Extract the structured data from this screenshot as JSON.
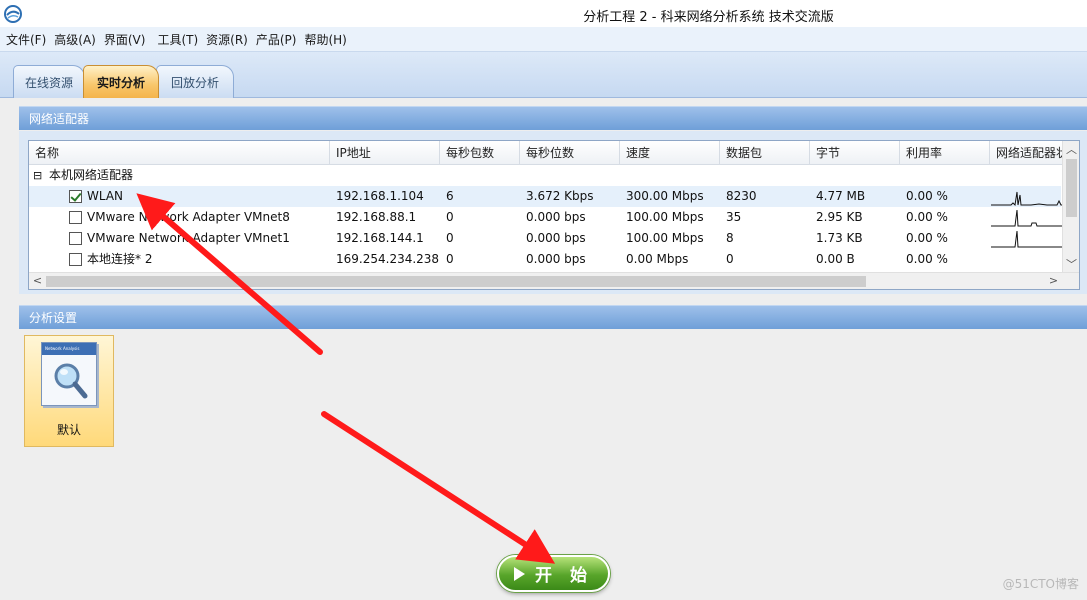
{
  "window": {
    "title": "分析工程 2 - 科来网络分析系统 技术交流版"
  },
  "menu": [
    "文件(F)",
    "高级(A)",
    "界面(V)",
    "工具(T)",
    "资源(R)",
    "产品(P)",
    "帮助(H)"
  ],
  "tabs": [
    {
      "label": "在线资源",
      "active": false
    },
    {
      "label": "实时分析",
      "active": true
    },
    {
      "label": "回放分析",
      "active": false
    }
  ],
  "adapter_panel": {
    "title": "网络适配器",
    "columns": [
      "名称",
      "IP地址",
      "每秒包数",
      "每秒位数",
      "速度",
      "数据包",
      "字节",
      "利用率",
      "网络适配器状态"
    ],
    "group": {
      "toggle": "⊟",
      "label": "本机网络适配器"
    },
    "rows": [
      {
        "checked": true,
        "name": "WLAN",
        "ip": "192.168.1.104",
        "pps": "6",
        "bps": "3.672 Kbps",
        "speed": "300.00 Mbps",
        "packets": "8230",
        "bytes": "4.77 MB",
        "util": "0.00 %"
      },
      {
        "checked": false,
        "name": "VMware Network Adapter VMnet8",
        "ip": "192.168.88.1",
        "pps": "0",
        "bps": "0.000 bps",
        "speed": "100.00 Mbps",
        "packets": "35",
        "bytes": "2.95 KB",
        "util": "0.00 %"
      },
      {
        "checked": false,
        "name": "VMware Network Adapter VMnet1",
        "ip": "192.168.144.1",
        "pps": "0",
        "bps": "0.000 bps",
        "speed": "100.00 Mbps",
        "packets": "8",
        "bytes": "1.73 KB",
        "util": "0.00 %"
      },
      {
        "checked": false,
        "name": "本地连接* 2",
        "ip": "169.254.234.238",
        "pps": "0",
        "bps": "0.000 bps",
        "speed": "0.00 Mbps",
        "packets": "0",
        "bytes": "0.00 B",
        "util": "0.00 %"
      }
    ]
  },
  "settings_panel": {
    "title": "分析设置",
    "preset": {
      "label": "默认",
      "icon_caption": "Network Analysis",
      "icon": "network-analysis-magnifier-icon"
    }
  },
  "start_button": {
    "label": "开 始",
    "icon": "play-icon"
  },
  "watermark": "@51CTO博客",
  "colors": {
    "accent": "#f8c66a",
    "header_blue": "#6f9fd8",
    "start_green": "#58a52a",
    "annotation_red": "#ff0000"
  }
}
